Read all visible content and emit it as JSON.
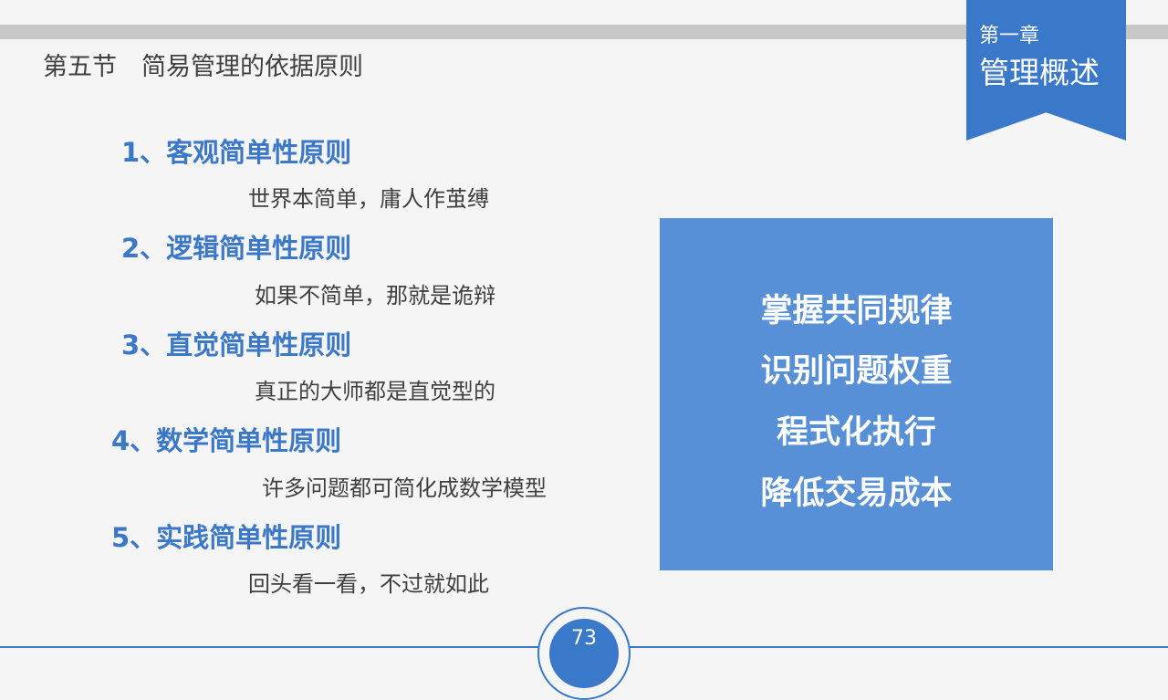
{
  "header": {
    "section_title": "第五节　简易管理的依据原则"
  },
  "chapter": {
    "number": "第一章",
    "title": "管理概述"
  },
  "principles": [
    {
      "heading": "1、客观简单性原则",
      "description": "世界本简单，庸人作茧缚"
    },
    {
      "heading": "2、逻辑简单性原则",
      "description": "如果不简单，那就是诡辩"
    },
    {
      "heading": "3、直觉简单性原则",
      "description": "真正的大师都是直觉型的"
    },
    {
      "heading": "4、数学简单性原则",
      "description": "许多问题都可简化成数学模型"
    },
    {
      "heading": "5、实践简单性原则",
      "description": "回头看一看，不过就如此"
    }
  ],
  "key_points": [
    "掌握共同规律",
    "识别问题权重",
    "程式化执行",
    "降低交易成本"
  ],
  "footer": {
    "page_number": "73"
  },
  "colors": {
    "accent": "#3a78c9",
    "heading_blue": "#3b78c8",
    "box_blue": "#5790d6",
    "text_dark": "#404040"
  }
}
